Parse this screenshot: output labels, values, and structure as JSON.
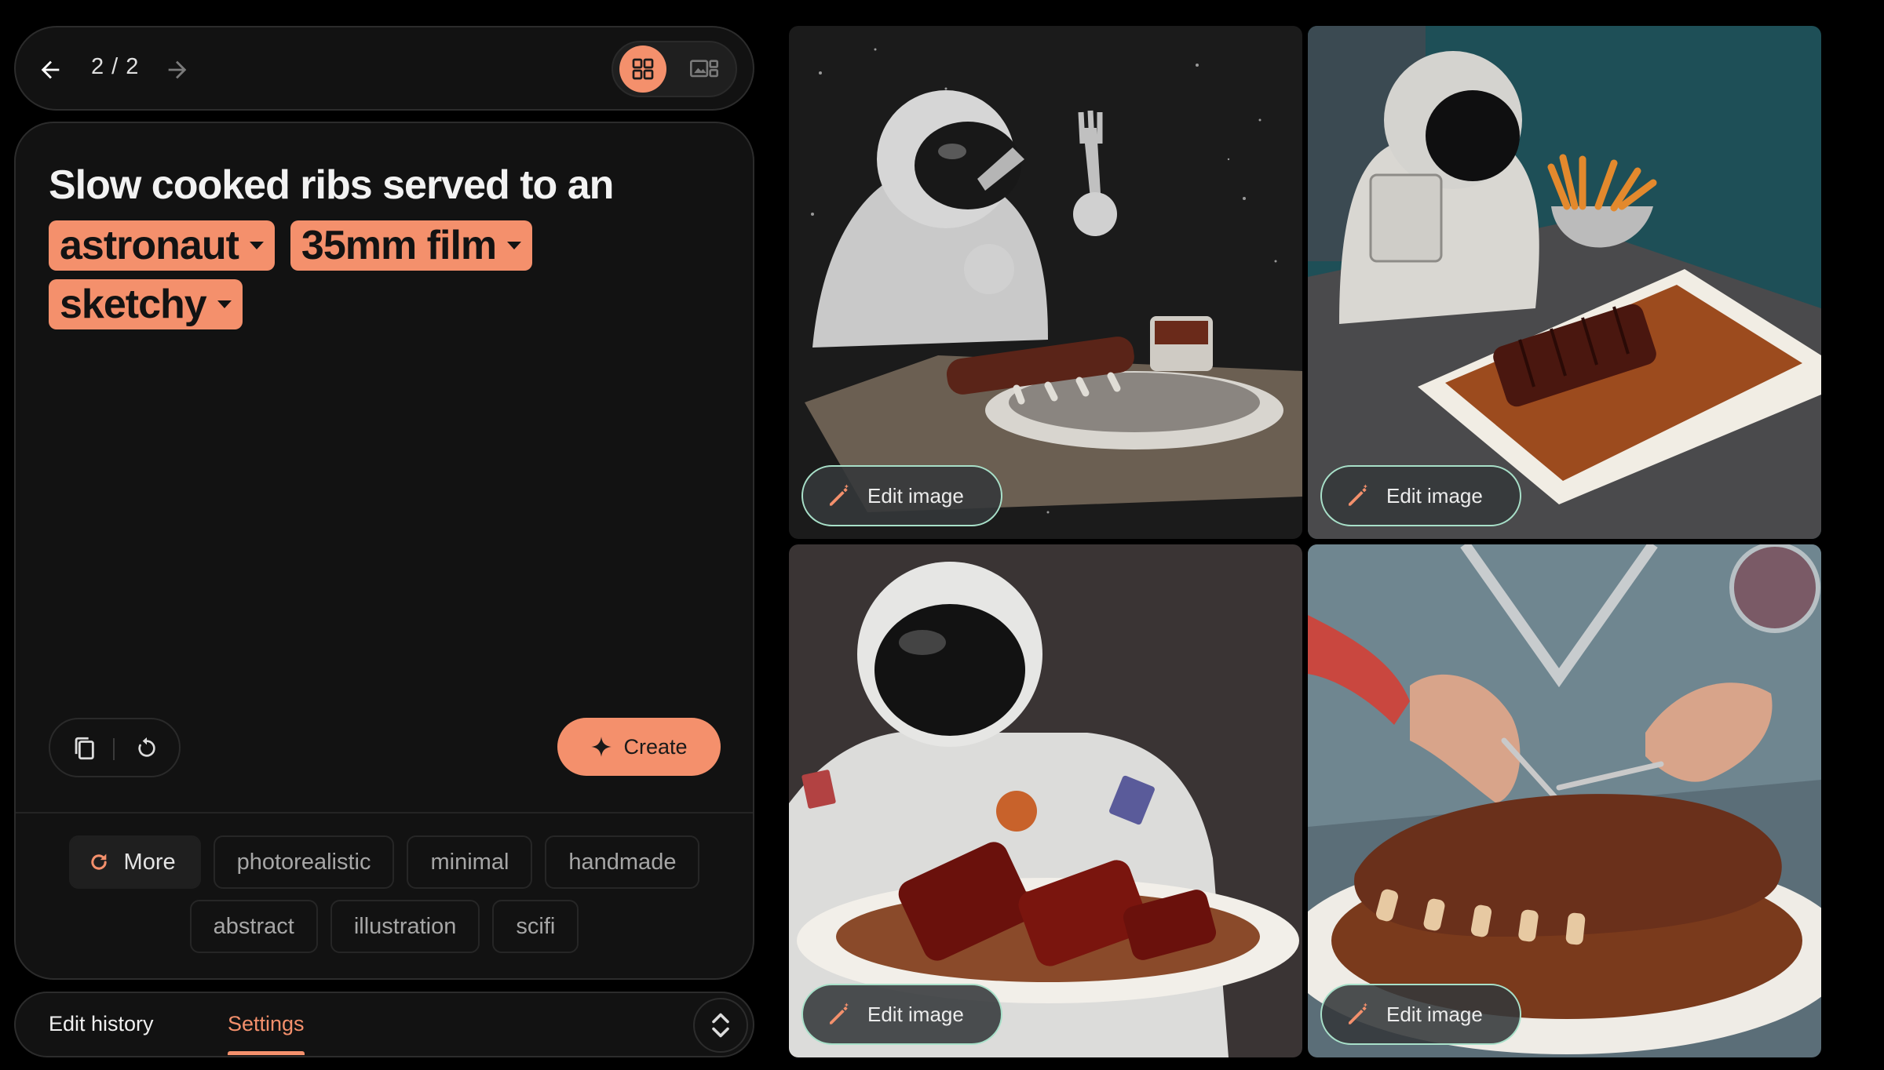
{
  "topbar": {
    "page_counter": "2 / 2",
    "icons": {
      "back": "arrow-left-icon",
      "forward": "arrow-right-icon",
      "grid_view": "grid-icon",
      "single_view": "single-image-view-icon"
    }
  },
  "prompt": {
    "text": "Slow cooked ribs served to an",
    "chips": [
      {
        "label": "astronaut"
      },
      {
        "label": "35mm film"
      },
      {
        "label": "sketchy"
      }
    ]
  },
  "actions": {
    "create_label": "Create",
    "icons": {
      "copy": "copy-icon",
      "reset": "reset-icon",
      "create": "sparkle-icon"
    }
  },
  "suggestions": {
    "more_label": "More",
    "items": [
      "photorealistic",
      "minimal",
      "handmade",
      "abstract",
      "illustration",
      "scifi"
    ]
  },
  "tabs": {
    "edit_history": "Edit history",
    "settings": "Settings",
    "active": "settings"
  },
  "images": [
    {
      "edit_label": "Edit image",
      "style": "sketch"
    },
    {
      "edit_label": "Edit image",
      "style": "film"
    },
    {
      "edit_label": "Edit image",
      "style": "film"
    },
    {
      "edit_label": "Edit image",
      "style": "film"
    }
  ],
  "colors": {
    "accent": "#f4906c",
    "background": "#000000",
    "panel": "#121212",
    "edit_button_border": "#a8e0c9"
  }
}
